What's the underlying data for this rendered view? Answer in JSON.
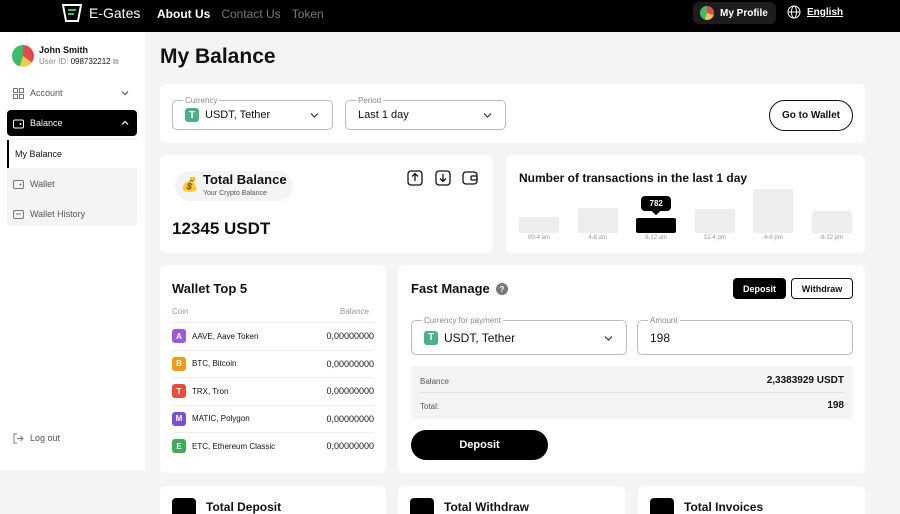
{
  "topbar": {
    "brand": "E-Gates",
    "nav": [
      {
        "label": "About Us"
      },
      {
        "label": "Contact Us"
      },
      {
        "label": "Token"
      }
    ],
    "profile_label": "My Profile",
    "language": "English"
  },
  "sidebar": {
    "user_name": "John Smith",
    "user_id_label": "User ID:",
    "user_id": "098732212",
    "items": [
      {
        "label": "Account"
      },
      {
        "label": "Balance"
      }
    ],
    "subitems": [
      {
        "label": "My Balance"
      },
      {
        "label": "Wallet"
      },
      {
        "label": "Wallet History"
      }
    ],
    "logout": "Log out"
  },
  "page": {
    "title": "My Balance"
  },
  "filters": {
    "currency_label": "Currency",
    "currency_value": "USDT, Tether",
    "period_label": "Period",
    "period_value": "Last 1 day",
    "go_wallet": "Go to Wallet"
  },
  "total_balance": {
    "title": "Total Balance",
    "subtitle": "Your Crypto Balance",
    "amount": "12345 USDT"
  },
  "chart_data": {
    "type": "bar",
    "title": "Number of transactions in the last 1 day",
    "categories": [
      "00-4 am",
      "4-8 am",
      "8-12 am",
      "12-4 pm",
      "4-8 pm",
      "8-12 pm"
    ],
    "values": [
      180,
      280,
      170,
      270,
      490,
      250
    ],
    "active_index": 2,
    "tooltip": "782"
  },
  "wallet_top": {
    "title": "Wallet Top 5",
    "col_coin": "Coin",
    "col_balance": "Balance",
    "rows": [
      {
        "coin": "AAVE, Aave Token",
        "balance": "0,00000000",
        "color": "#9b59d9",
        "glyph": "A"
      },
      {
        "coin": "BTC, Bitcoin",
        "balance": "0,00000000",
        "color": "#f39c12",
        "glyph": "B"
      },
      {
        "coin": "TRX, Tron",
        "balance": "0,00000000",
        "color": "#e74c3c",
        "glyph": "T"
      },
      {
        "coin": "MATIC, Polygon",
        "balance": "0,00000000",
        "color": "#7b4fd6",
        "glyph": "M"
      },
      {
        "coin": "ETC, Ethereum Classic",
        "balance": "0,00000000",
        "color": "#3daa5c",
        "glyph": "E"
      }
    ]
  },
  "fast_manage": {
    "title": "Fast Manage",
    "help": "?",
    "tab_deposit": "Deposit",
    "tab_withdraw": "Withdraw",
    "currency_label": "Currency for payment",
    "currency_value": "USDT, Tether",
    "amount_label": "Amount",
    "amount_value": "198",
    "balance_label": "Balance",
    "balance_value": "2,3383929 USDT",
    "total_label": "Total:",
    "total_value": "198",
    "submit": "Deposit"
  },
  "bottom": {
    "deposit": "Total Deposit",
    "withdraw": "Total Withdraw",
    "invoices": "Total Invoices"
  }
}
